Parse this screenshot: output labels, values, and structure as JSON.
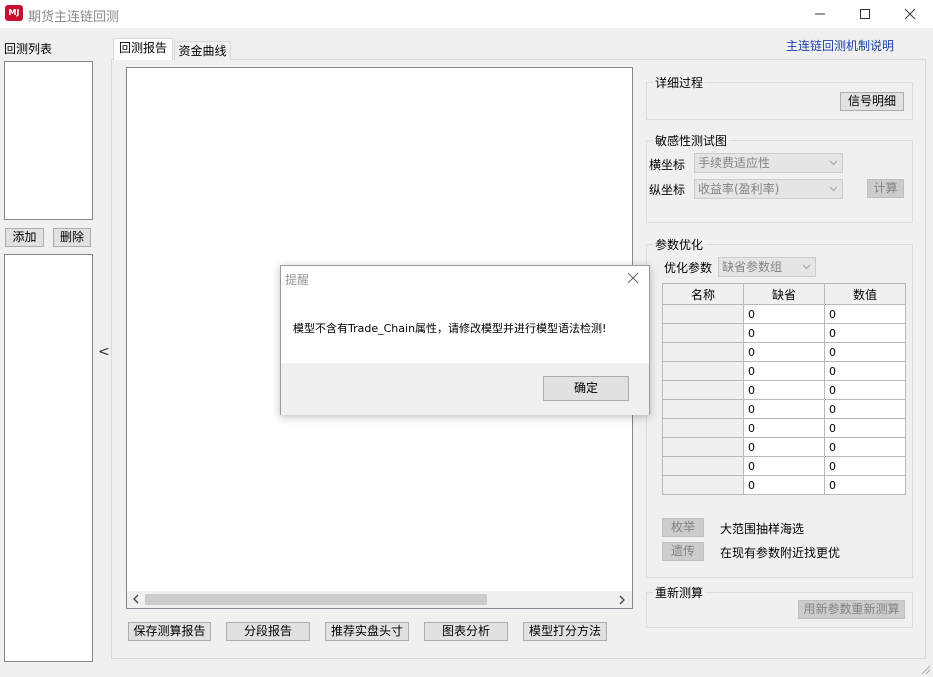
{
  "window": {
    "logo_text": "MJ",
    "title": "期货主连链回测",
    "controls": [
      "minimize-icon",
      "maximize-icon",
      "close-icon"
    ]
  },
  "left": {
    "list_title": "回测列表",
    "add_label": "添加",
    "delete_label": "删除",
    "collapse_glyph": "<"
  },
  "tabs": [
    {
      "label": "回测报告",
      "active": true
    },
    {
      "label": "资金曲线",
      "active": false
    }
  ],
  "top_link": "主连链回测机制说明",
  "bottom_buttons": [
    "保存测算报告",
    "分段报告",
    "推荐实盘头寸",
    "图表分析",
    "模型打分方法"
  ],
  "detail": {
    "title": "详细过程",
    "signal_button": "信号明细"
  },
  "sensitivity": {
    "title": "敏感性测试图",
    "x_label": "横坐标",
    "x_value": "手续费适应性",
    "y_label": "纵坐标",
    "y_value": "收益率(盈利率)",
    "compute_button": "计算"
  },
  "optimize": {
    "title": "参数优化",
    "param_label": "优化参数",
    "param_value": "缺省参数组",
    "headers": [
      "名称",
      "缺省",
      "数值"
    ],
    "rows": [
      [
        "",
        "0",
        "0"
      ],
      [
        "",
        "0",
        "0"
      ],
      [
        "",
        "0",
        "0"
      ],
      [
        "",
        "0",
        "0"
      ],
      [
        "",
        "0",
        "0"
      ],
      [
        "",
        "0",
        "0"
      ],
      [
        "",
        "0",
        "0"
      ],
      [
        "",
        "0",
        "0"
      ],
      [
        "",
        "0",
        "0"
      ],
      [
        "",
        "0",
        "0"
      ]
    ],
    "enum_button": "枚举",
    "enum_desc": "大范围抽样海选",
    "genetic_button": "遗传",
    "genetic_desc": "在现有参数附近找更优"
  },
  "recalc": {
    "title": "重新测算",
    "button": "用新参数重新测算"
  },
  "dialog": {
    "title": "提醒",
    "message": "模型不含有Trade_Chain属性，请修改模型并进行模型语法检测!",
    "ok_label": "确定"
  },
  "colors": {
    "link": "#1a3fa8",
    "logo_red": "#c8102e",
    "disabled_text": "#838383"
  }
}
